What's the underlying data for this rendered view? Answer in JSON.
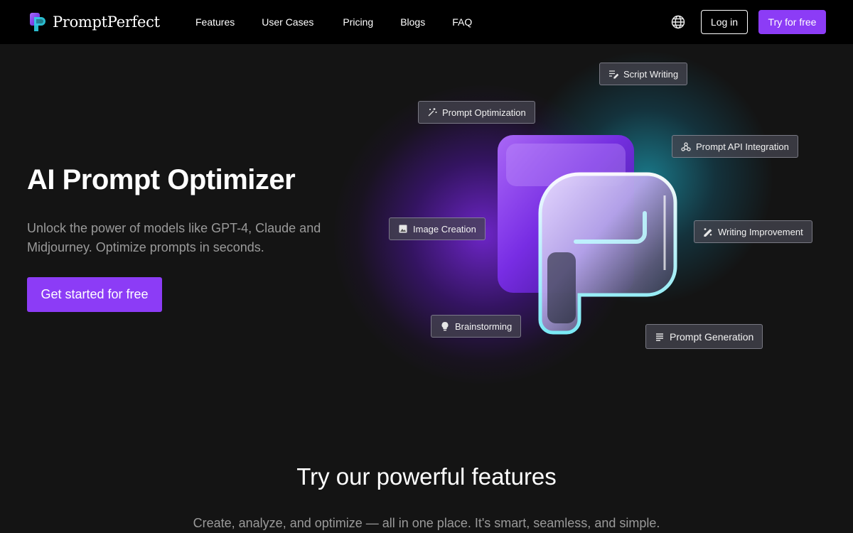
{
  "brand": {
    "name": "PromptPerfect",
    "primary_color": "#8c3cf6",
    "accent_cyan": "#1ec8e6"
  },
  "nav": {
    "links": [
      "Features",
      "User Cases",
      "Pricing",
      "Blogs",
      "FAQ"
    ],
    "language_icon": "globe-icon",
    "login_label": "Log in",
    "try_label": "Try for free"
  },
  "hero": {
    "title": "AI Prompt Optimizer",
    "subtitle": "Unlock the power of models like GPT-4, Claude and Midjourney. Optimize prompts in seconds.",
    "cta_label": "Get started for free"
  },
  "chips": {
    "script_writing": {
      "label": "Script Writing",
      "icon": "edit-lines-icon"
    },
    "prompt_optimization": {
      "label": "Prompt Optimization",
      "icon": "magic-wand-icon"
    },
    "prompt_api": {
      "label": "Prompt API Integration",
      "icon": "webhook-icon"
    },
    "image_creation": {
      "label": "Image Creation",
      "icon": "image-icon"
    },
    "writing_improvement": {
      "label": "Writing Improvement",
      "icon": "pen-sparkle-icon"
    },
    "brainstorming": {
      "label": "Brainstorming",
      "icon": "lightbulb-icon"
    },
    "prompt_generation": {
      "label": "Prompt Generation",
      "icon": "text-lines-icon"
    }
  },
  "features": {
    "title": "Try our powerful features",
    "subtitle": "Create, analyze, and optimize — all in one place. It's smart, seamless, and simple."
  }
}
